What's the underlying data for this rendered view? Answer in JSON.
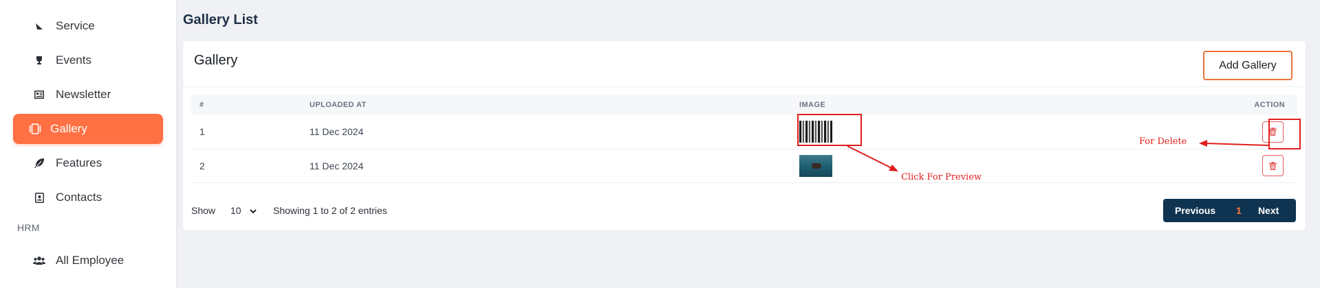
{
  "sidebar": {
    "items": [
      {
        "label": "Service",
        "icon": "service-icon"
      },
      {
        "label": "Events",
        "icon": "trophy-icon"
      },
      {
        "label": "Newsletter",
        "icon": "newspaper-icon"
      },
      {
        "label": "Gallery",
        "icon": "gallery-icon",
        "active": true
      },
      {
        "label": "Features",
        "icon": "feather-icon"
      },
      {
        "label": "Contacts",
        "icon": "contact-card-icon"
      }
    ],
    "section_label": "HRM",
    "hrm_items": [
      {
        "label": "All Employee",
        "icon": "users-icon"
      }
    ]
  },
  "page": {
    "title": "Gallery List"
  },
  "card": {
    "title": "Gallery",
    "add_button_label": "Add Gallery"
  },
  "table": {
    "headers": [
      "#",
      "UPLOADED AT",
      "IMAGE",
      "ACTION"
    ],
    "rows": [
      {
        "index": "1",
        "uploaded_at": "11 Dec 2024",
        "image": "gallery-thumbnail-1"
      },
      {
        "index": "2",
        "uploaded_at": "11 Dec 2024",
        "image": "gallery-thumbnail-2"
      }
    ]
  },
  "footer": {
    "show_label": "Show",
    "page_size": "10",
    "info": "Showing 1 to 2 of 2 entries",
    "previous_label": "Previous",
    "current_page": "1",
    "next_label": "Next"
  },
  "annotations": {
    "preview": "Click For Preview",
    "delete": "For Delete"
  },
  "colors": {
    "accent": "#ff7043",
    "pager_bg": "#0f3451",
    "annotation": "#e11d1d",
    "delete": "#e45b5b"
  }
}
